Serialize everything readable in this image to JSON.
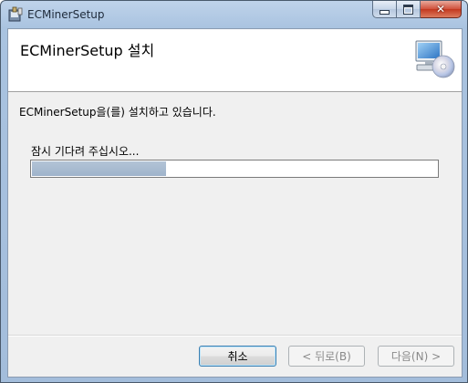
{
  "window": {
    "title": "ECMinerSetup",
    "controls": {
      "minimize": "minimize-icon",
      "maximize": "maximize-icon",
      "close": "close-icon"
    }
  },
  "header": {
    "title": "ECMinerSetup 설치",
    "icon": "computer-cd-icon"
  },
  "body": {
    "status_text": "ECMinerSetup을(를) 설치하고 있습니다.",
    "wait_text": "잠시 기다려 주십시오...",
    "progress_fraction": 0.33
  },
  "footer": {
    "cancel_label": "취소",
    "back_label": "< 뒤로(B)",
    "next_label": "다음(N) >"
  },
  "colors": {
    "progress_fill": "#9fb4cb",
    "title_bar": "#a9c3e0",
    "close_button": "#c2381f"
  }
}
